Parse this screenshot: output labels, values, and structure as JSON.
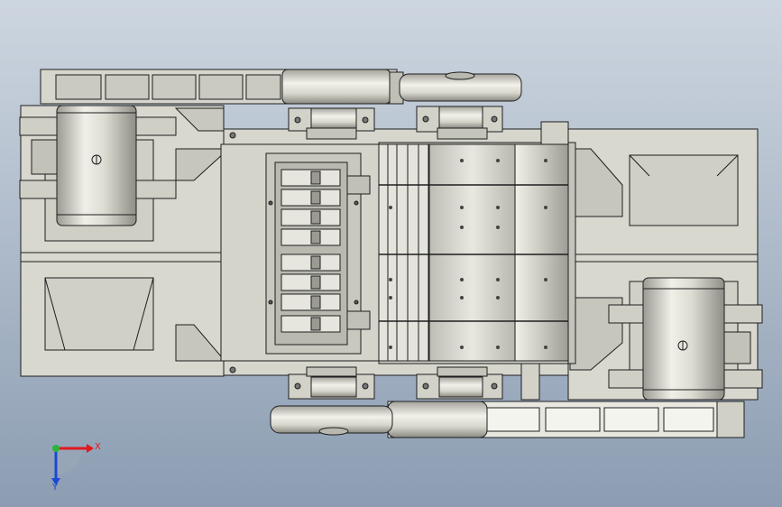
{
  "colors": {
    "background_top": "#c9d3de",
    "background_bottom": "#8b9cb1",
    "metal_fill": "#d8d8cf",
    "metal_light": "#ececE4",
    "metal_dark": "#9a9a92",
    "outline": "#1e1e1e",
    "axis_x": "#e0191f",
    "axis_y": "#1a49d6",
    "axis_z_dot": "#2bb43a"
  },
  "axes": {
    "x_label": "X",
    "y_label": "Y"
  },
  "components": {
    "left_motor": "motor",
    "right_motor": "motor",
    "top_belt_guard": "belt-guard",
    "bottom_belt_guard": "belt-guard",
    "crusher_housing": "housing",
    "rotor_drums": "rotor"
  }
}
